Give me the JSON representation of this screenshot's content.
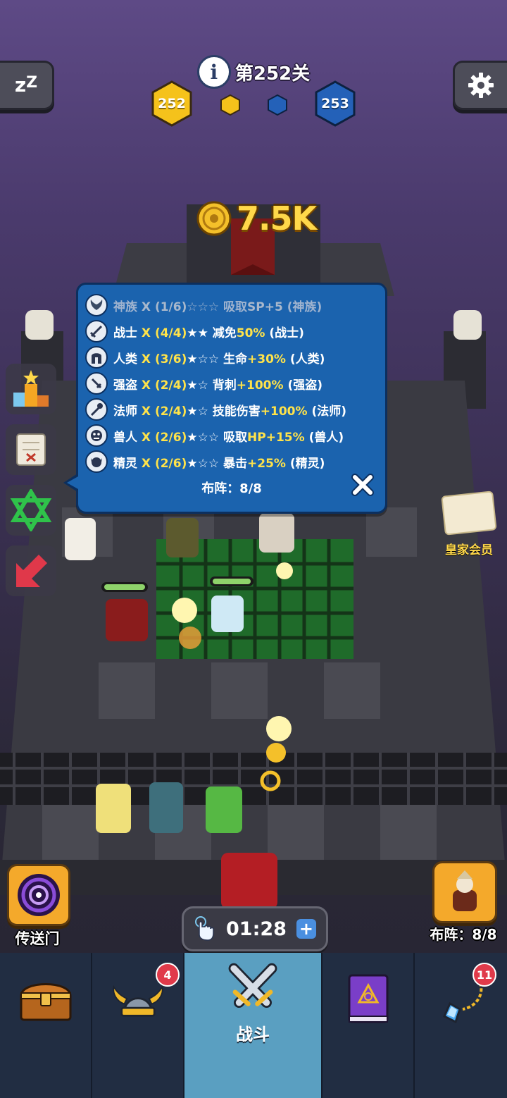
{
  "header": {
    "level_label": "第252关",
    "current_level": "252",
    "next_level": "253",
    "colors": {
      "current_hex": "#f5c21b",
      "next_hex": "#2461b8"
    }
  },
  "coins": {
    "amount": "7.5K"
  },
  "synergy_panel": {
    "rows": [
      {
        "icon": "wings-icon",
        "name": "神族",
        "count": "X (1/6)",
        "stars": "☆☆☆",
        "effect": "吸取",
        "value": "SP+5",
        "tag": "(神族)",
        "active": false
      },
      {
        "icon": "sword-icon",
        "name": "战士",
        "count": "X (4/4)",
        "stars": "★★",
        "effect": "减免",
        "value": "50%",
        "tag": "(战士)",
        "active": true
      },
      {
        "icon": "helmet-icon",
        "name": "人类",
        "count": "X (3/6)",
        "stars": "★☆☆",
        "effect": "生命",
        "value": "+30%",
        "tag": "(人类)",
        "active": true
      },
      {
        "icon": "dagger-icon",
        "name": "强盗",
        "count": "X (2/4)",
        "stars": "★☆",
        "effect": "背刺",
        "value": "+100%",
        "tag": "(强盗)",
        "active": true
      },
      {
        "icon": "staff-icon",
        "name": "法师",
        "count": "X (2/4)",
        "stars": "★☆",
        "effect": "技能伤害",
        "value": "+100%",
        "tag": "(法师)",
        "active": true
      },
      {
        "icon": "orc-face-icon",
        "name": "兽人",
        "count": "X (2/6)",
        "stars": "★☆☆",
        "effect": "吸取",
        "value": "HP+15%",
        "tag": "(兽人)",
        "active": true
      },
      {
        "icon": "elf-face-icon",
        "name": "精灵",
        "count": "X (2/6)",
        "stars": "★☆☆",
        "effect": "暴击",
        "value": "+25%",
        "tag": "(精灵)",
        "active": true
      }
    ],
    "formation": "布阵：8/8"
  },
  "side_menu": {
    "royal_label": "皇家会员"
  },
  "bottom": {
    "portal_label": "传送门",
    "timer": "01:28",
    "timer_plus": "+",
    "formation_label": "布阵：8/8"
  },
  "nav": {
    "items": [
      {
        "icon": "treasure-chest-icon",
        "label": "",
        "badge": ""
      },
      {
        "icon": "viking-helmet-icon",
        "label": "",
        "badge": "4"
      },
      {
        "icon": "crossed-swords-icon",
        "label": "战斗",
        "badge": ""
      },
      {
        "icon": "spellbook-icon",
        "label": "",
        "badge": ""
      },
      {
        "icon": "amulet-icon",
        "label": "",
        "badge": "11"
      }
    ]
  }
}
